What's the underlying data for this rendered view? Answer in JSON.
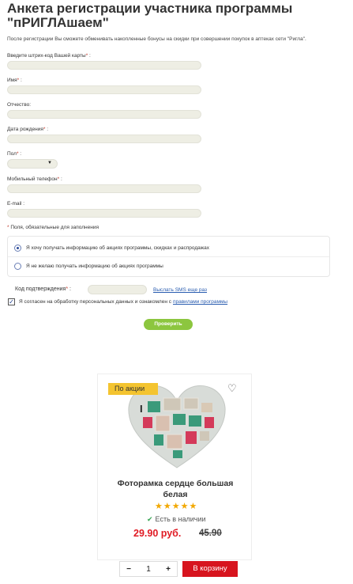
{
  "form": {
    "title": "Анкета регистрации участника программы \"пРИГЛАшаем\"",
    "intro": "После регистрации Вы сможете обменивать накопленные бонусы на скидки при совершении покупок в аптеках сети \"Ригла\".",
    "fields": {
      "card": {
        "label": "Введите штрих-код Вашей карты",
        "required_mark": "*",
        "colon": " :"
      },
      "name": {
        "label": "Имя",
        "required_mark": "*",
        "colon": " :"
      },
      "patronymic": {
        "label": "Отчество:",
        "required_mark": "",
        "colon": ""
      },
      "birthdate": {
        "label": "Дата рождения",
        "required_mark": "*",
        "colon": " :"
      },
      "gender": {
        "label": "Пол",
        "required_mark": "*",
        "colon": " :"
      },
      "phone": {
        "label": "Мобильный телефон",
        "required_mark": "*",
        "colon": " :"
      },
      "email": {
        "label": "E-mail :",
        "required_mark": "",
        "colon": ""
      }
    },
    "required_note": {
      "mark": "*",
      "text": " Поля, обязательные для заполнения"
    },
    "radio_options": [
      {
        "label": "Я хочу получать информацию об акциях программы, скидках и распродажах",
        "checked": true
      },
      {
        "label": "Я не желаю получать информацию об акциях программы",
        "checked": false
      }
    ],
    "code": {
      "label": "Код подтверждения",
      "required_mark": "*",
      "colon": " :",
      "resend_link": "Выслать SMS еще раз"
    },
    "consent": {
      "text": "Я согласен на обработку персональных данных и ознакомлен с",
      "link": "правилами программы",
      "checked": true
    },
    "submit_label": "Проверить"
  },
  "product": {
    "badge": "По акции",
    "name_line1": "Фоторамка сердце большая",
    "name_line2": "белая",
    "rating_stars": 5,
    "stars_text": "★★★★★",
    "stock_icon": "✔",
    "stock_text": "Есть в наличии",
    "price_new": "29.90 руб.",
    "price_old": "45.90",
    "quantity": "1",
    "qty_minus": "−",
    "qty_plus": "+",
    "cart_label": "В корзину",
    "heart_icon": "♡",
    "cursor_icon": "I"
  },
  "colors": {
    "accent_green": "#8cc63f",
    "badge_yellow": "#f4c430",
    "price_red": "#e01b24",
    "cart_red": "#d7141e",
    "input_bg": "#eeeee4"
  }
}
